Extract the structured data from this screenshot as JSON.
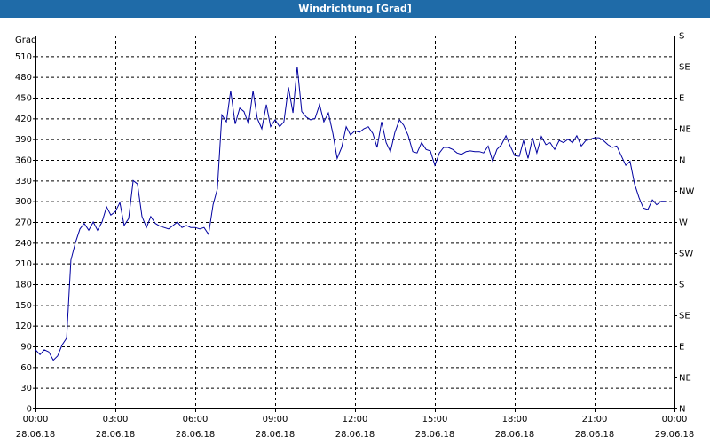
{
  "chart_data": {
    "type": "line",
    "title": "Windrichtung [Grad]",
    "ylabel": "Grad",
    "ylim": [
      0,
      540
    ],
    "yticks": [
      0,
      30,
      60,
      90,
      120,
      150,
      180,
      210,
      240,
      270,
      300,
      330,
      360,
      390,
      420,
      450,
      480,
      510
    ],
    "y2ticks": [
      "N",
      "NE",
      "E",
      "SE",
      "S",
      "SW",
      "W",
      "NW",
      "N",
      "NE",
      "E",
      "SE",
      "S"
    ],
    "xlim_hours": [
      0,
      24
    ],
    "xticks": [
      {
        "time": "00:00",
        "date": "28.06.18"
      },
      {
        "time": "03:00",
        "date": "28.06.18"
      },
      {
        "time": "06:00",
        "date": "28.06.18"
      },
      {
        "time": "09:00",
        "date": "28.06.18"
      },
      {
        "time": "12:00",
        "date": "28.06.18"
      },
      {
        "time": "15:00",
        "date": "28.06.18"
      },
      {
        "time": "18:00",
        "date": "28.06.18"
      },
      {
        "time": "21:00",
        "date": "28.06.18"
      },
      {
        "time": "00:00",
        "date": "29.06.18"
      }
    ],
    "grid": true,
    "line_color": "#0000a0",
    "series": [
      {
        "hours": [
          0.0,
          0.17,
          0.33,
          0.5,
          0.67,
          0.83,
          1.0,
          1.17,
          1.33,
          1.5,
          1.67,
          1.83,
          2.0,
          2.17,
          2.33,
          2.5,
          2.67,
          2.83,
          3.0,
          3.17,
          3.33,
          3.5,
          3.67,
          3.83,
          4.0,
          4.17,
          4.33,
          4.5,
          4.67,
          4.83,
          5.0,
          5.17,
          5.33,
          5.5,
          5.67,
          5.83,
          6.0,
          6.17,
          6.33,
          6.5,
          6.67,
          6.83,
          7.0,
          7.17,
          7.33,
          7.5,
          7.67,
          7.83,
          8.0,
          8.17,
          8.33,
          8.5,
          8.67,
          8.83,
          9.0,
          9.17,
          9.33,
          9.5,
          9.67,
          9.83,
          10.0,
          10.17,
          10.33,
          10.5,
          10.67,
          10.83,
          11.0,
          11.17,
          11.33,
          11.5,
          11.67,
          11.83,
          12.0,
          12.17,
          12.33,
          12.5,
          12.67,
          12.83,
          13.0,
          13.17,
          13.33,
          13.5,
          13.67,
          13.83,
          14.0,
          14.17,
          14.33,
          14.5,
          14.67,
          14.83,
          15.0,
          15.17,
          15.33,
          15.5,
          15.67,
          15.83,
          16.0,
          16.17,
          16.33,
          16.5,
          16.67,
          16.83,
          17.0,
          17.17,
          17.33,
          17.5,
          17.67,
          17.83,
          18.0,
          18.17,
          18.33,
          18.5,
          18.67,
          18.83,
          19.0,
          19.17,
          19.33,
          19.5,
          19.67,
          19.83,
          20.0,
          20.17,
          20.33,
          20.5,
          20.67,
          20.83,
          21.0,
          21.17,
          21.33,
          21.5,
          21.67,
          21.83,
          22.0,
          22.17,
          22.33,
          22.5,
          22.67,
          22.83,
          23.0,
          23.17,
          23.33,
          23.5,
          23.67,
          23.83,
          24.0
        ],
        "values": [
          85,
          78,
          85,
          82,
          70,
          76,
          92,
          102,
          215,
          240,
          260,
          268,
          258,
          270,
          258,
          270,
          292,
          280,
          285,
          298,
          265,
          275,
          330,
          325,
          278,
          262,
          278,
          268,
          264,
          262,
          260,
          265,
          270,
          262,
          265,
          262,
          262,
          260,
          262,
          252,
          295,
          318,
          425,
          415,
          460,
          412,
          435,
          430,
          412,
          460,
          420,
          405,
          440,
          408,
          418,
          408,
          415,
          465,
          428,
          495,
          430,
          422,
          418,
          420,
          440,
          415,
          428,
          398,
          362,
          378,
          408,
          396,
          402,
          400,
          405,
          408,
          398,
          378,
          415,
          385,
          372,
          400,
          418,
          410,
          395,
          372,
          370,
          385,
          375,
          373,
          352,
          370,
          378,
          378,
          375,
          370,
          368,
          372,
          373,
          372,
          372,
          370,
          380,
          358,
          375,
          382,
          395,
          380,
          366,
          365,
          388,
          362,
          392,
          370,
          394,
          382,
          385,
          375,
          388,
          385,
          390,
          385,
          395,
          380,
          388,
          390,
          392,
          392,
          388,
          382,
          378,
          380,
          366,
          352,
          358,
          325,
          305,
          290,
          288,
          302,
          295,
          300,
          300
        ]
      }
    ]
  }
}
